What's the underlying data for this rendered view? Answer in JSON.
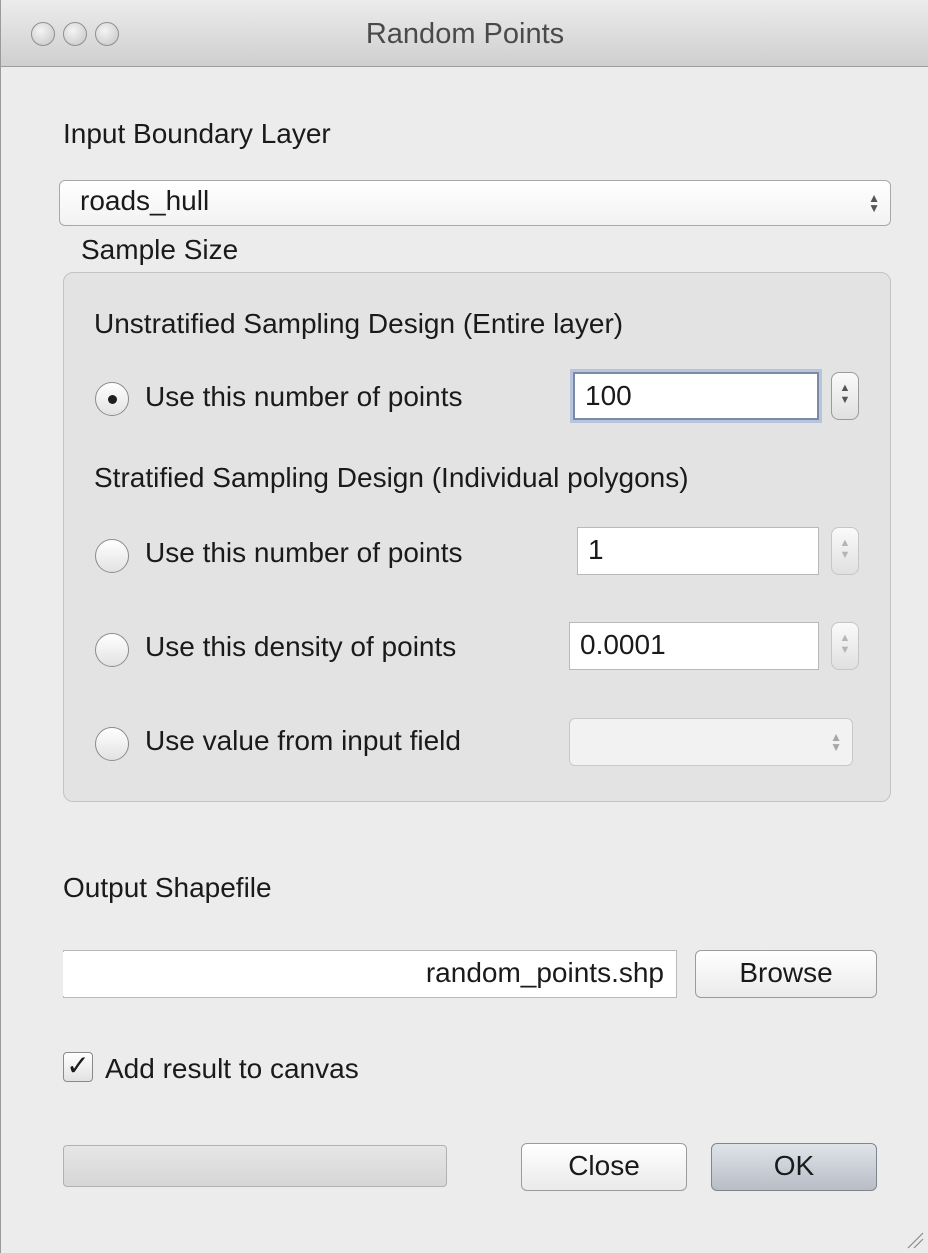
{
  "window": {
    "title": "Random Points"
  },
  "input": {
    "label": "Input Boundary Layer",
    "value": "roads_hull"
  },
  "sample": {
    "label": "Sample Size",
    "unstratified": {
      "heading": "Unstratified Sampling Design (Entire layer)",
      "option_label": "Use this number of points",
      "value": "100",
      "selected": true
    },
    "stratified": {
      "heading": "Stratified Sampling Design (Individual polygons)",
      "number": {
        "label": "Use this number of points",
        "value": "1"
      },
      "density": {
        "label": "Use this density of points",
        "value": "0.0001"
      },
      "field": {
        "label": "Use value from input field",
        "value": ""
      }
    }
  },
  "output": {
    "label": "Output Shapefile",
    "path": "random_points.shp",
    "browse_label": "Browse"
  },
  "add_result": {
    "label": "Add result to canvas",
    "checked": true
  },
  "buttons": {
    "close": "Close",
    "ok": "OK"
  },
  "colors": {
    "window_bg": "#ececec",
    "focus_ring": "#b6c4de"
  }
}
